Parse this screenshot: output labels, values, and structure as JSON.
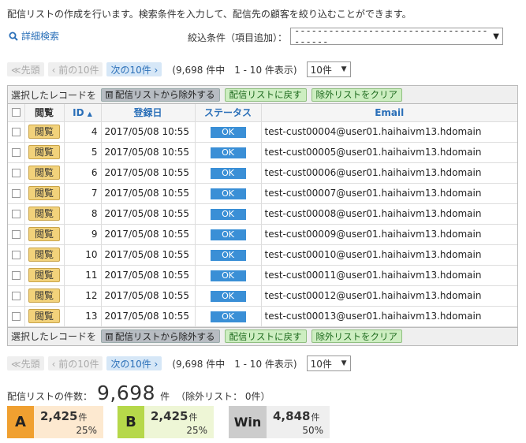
{
  "description": "配信リストの作成を行います。検索条件を入力して、配信先の顧客を絞り込むことができます。",
  "advanced_search": "詳細検索",
  "filter": {
    "label": "絞込条件（項目追加）：",
    "value": "----------------------------------------"
  },
  "pager": {
    "first": "≪先頭",
    "prev": "‹ 前の10件",
    "next": "次の10件 ›",
    "info": "(9,698 件中　1 - 10 件表示)",
    "per_page": "10件"
  },
  "actions": {
    "label": "選択したレコードを",
    "exclude": "配信リストから除外する",
    "restore": "配信リストに戻す",
    "clear": "除外リストをクリア"
  },
  "columns": {
    "view": "閲覧",
    "id": "ID",
    "registered": "登録日",
    "status": "ステータス",
    "email": "Email"
  },
  "rows": [
    {
      "view": "閲覧",
      "id": "4",
      "date": "2017/05/08 10:55",
      "status": "OK",
      "email": "test-cust00004@user01.haihaivm13.hdomain"
    },
    {
      "view": "閲覧",
      "id": "5",
      "date": "2017/05/08 10:55",
      "status": "OK",
      "email": "test-cust00005@user01.haihaivm13.hdomain"
    },
    {
      "view": "閲覧",
      "id": "6",
      "date": "2017/05/08 10:55",
      "status": "OK",
      "email": "test-cust00006@user01.haihaivm13.hdomain"
    },
    {
      "view": "閲覧",
      "id": "7",
      "date": "2017/05/08 10:55",
      "status": "OK",
      "email": "test-cust00007@user01.haihaivm13.hdomain"
    },
    {
      "view": "閲覧",
      "id": "8",
      "date": "2017/05/08 10:55",
      "status": "OK",
      "email": "test-cust00008@user01.haihaivm13.hdomain"
    },
    {
      "view": "閲覧",
      "id": "9",
      "date": "2017/05/08 10:55",
      "status": "OK",
      "email": "test-cust00009@user01.haihaivm13.hdomain"
    },
    {
      "view": "閲覧",
      "id": "10",
      "date": "2017/05/08 10:55",
      "status": "OK",
      "email": "test-cust00010@user01.haihaivm13.hdomain"
    },
    {
      "view": "閲覧",
      "id": "11",
      "date": "2017/05/08 10:55",
      "status": "OK",
      "email": "test-cust00011@user01.haihaivm13.hdomain"
    },
    {
      "view": "閲覧",
      "id": "12",
      "date": "2017/05/08 10:55",
      "status": "OK",
      "email": "test-cust00012@user01.haihaivm13.hdomain"
    },
    {
      "view": "閲覧",
      "id": "13",
      "date": "2017/05/08 10:55",
      "status": "OK",
      "email": "test-cust00013@user01.haihaivm13.hdomain"
    }
  ],
  "summary": {
    "label": "配信リストの件数：",
    "count": "9,698",
    "unit": "件",
    "excluded": "（除外リスト： 0件）"
  },
  "segments": [
    {
      "tag": "A",
      "value": "2,425",
      "unit": "件",
      "pct": "25%",
      "tag_color": "#f0a030",
      "bg_color": "#fde9d0"
    },
    {
      "tag": "B",
      "value": "2,425",
      "unit": "件",
      "pct": "25%",
      "tag_color": "#b6d84a",
      "bg_color": "#eef6d6"
    },
    {
      "tag": "Win",
      "value": "4,848",
      "unit": "件",
      "pct": "50%",
      "tag_color": "#cccccc",
      "bg_color": "#efefef"
    }
  ],
  "colors": {
    "link": "#2a6fb8",
    "ok": "#3a8fd6",
    "view_button": "#f2d27b"
  },
  "icons": {
    "search": "search-icon",
    "trash": "trash-icon",
    "sort": "sort-asc-icon",
    "dropdown": "chevron-down-icon"
  }
}
